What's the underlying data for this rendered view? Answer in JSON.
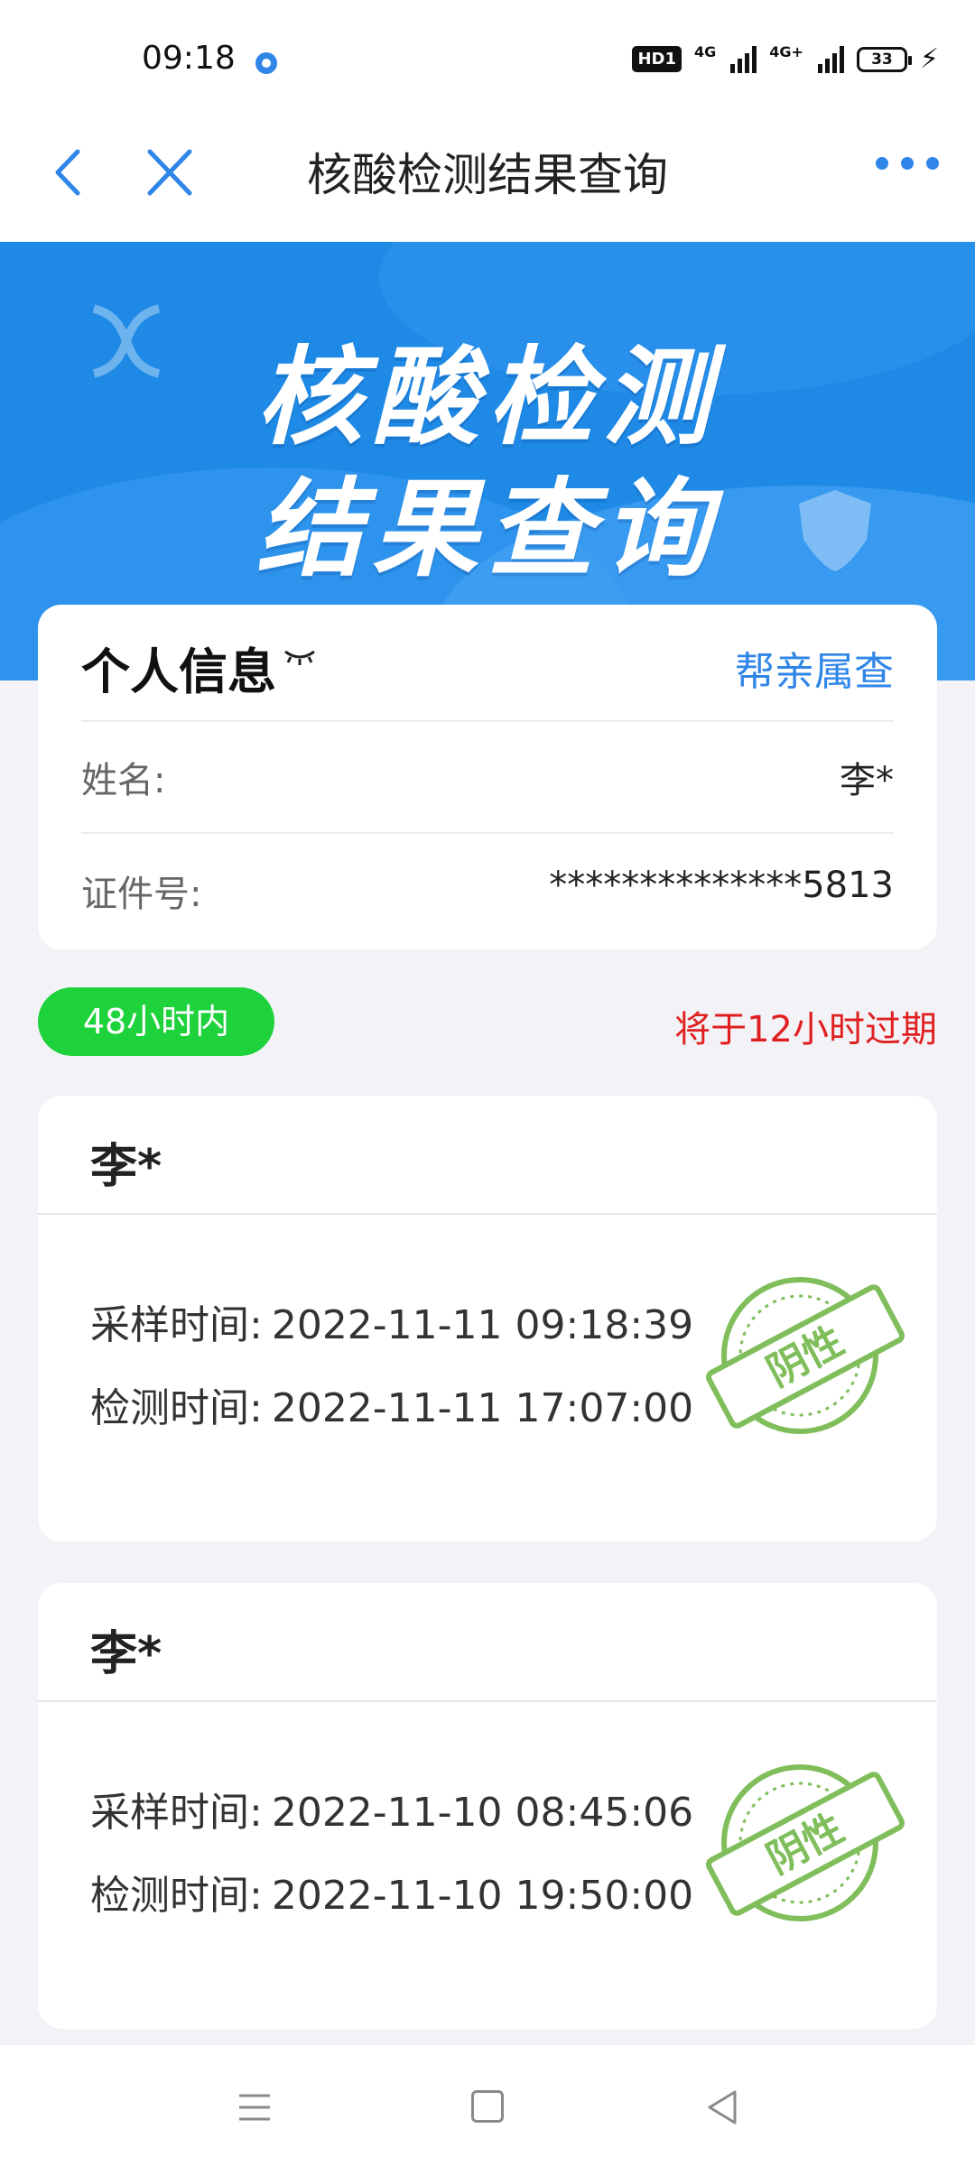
{
  "status_bar": {
    "time": "09:18",
    "hd_label": "HD1",
    "net1": "4G",
    "net2": "4G+",
    "battery": "33"
  },
  "navbar": {
    "title": "核酸检测结果查询"
  },
  "banner": {
    "line1": "核酸检测",
    "line2": "结果查询"
  },
  "personal_info": {
    "heading": "个人信息",
    "family_link": "帮亲属查",
    "name_label": "姓名:",
    "name_value": "李*",
    "id_label": "证件号:",
    "id_value": "**************5813"
  },
  "validity": {
    "badge": "48小时内",
    "expire_text": "将于12小时过期"
  },
  "results": [
    {
      "name": "李*",
      "sample_label": "采样时间:",
      "sample_time": "2022-11-11 09:18:39",
      "test_label": "检测时间:",
      "test_time": "2022-11-11 17:07:00",
      "stamp": "阴性"
    },
    {
      "name": "李*",
      "sample_label": "采样时间:",
      "sample_time": "2022-11-10 08:45:06",
      "test_label": "检测时间:",
      "test_time": "2022-11-10 19:50:00",
      "stamp": "阴性"
    }
  ],
  "colors": {
    "accent": "#2f86e8",
    "banner": "#1f8ae6",
    "badge_green": "#1ed23c",
    "expire_red": "#e02020",
    "stamp_green": "#7fbe5a"
  },
  "icons": [
    "back-arrow-icon",
    "close-icon",
    "more-dots-icon",
    "eye-closed-icon",
    "menu-icon",
    "home-icon",
    "back-triangle-icon"
  ]
}
